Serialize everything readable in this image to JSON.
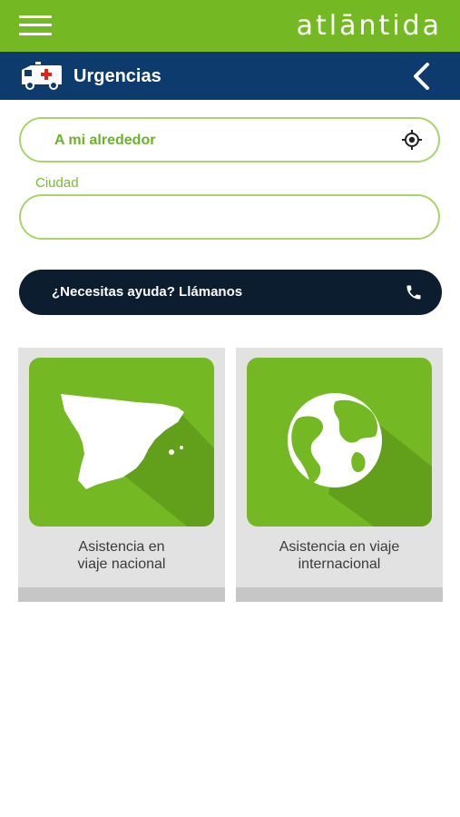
{
  "header": {
    "brand": "atlāntida",
    "menu_icon": "hamburger-menu-icon"
  },
  "subheader": {
    "title": "Urgencias",
    "left_icon": "ambulance-icon",
    "back_icon": "chevron-left-icon"
  },
  "location": {
    "value": "A mi alrededor",
    "icon": "crosshair-target-icon"
  },
  "city": {
    "label": "Ciudad",
    "value": ""
  },
  "help": {
    "label": "¿Necesitas ayuda? Llámanos",
    "icon": "phone-icon"
  },
  "cards": [
    {
      "line1": "Asistencia en",
      "line2": "viaje nacional",
      "icon": "spain-map-icon"
    },
    {
      "line1": "Asistencia en viaje",
      "line2": "internacional",
      "icon": "globe-icon"
    }
  ],
  "colors": {
    "brand_green": "#74b824",
    "navy": "#0d3b6e",
    "dark_button": "#0d1d30",
    "field_border": "#a9d36d"
  }
}
